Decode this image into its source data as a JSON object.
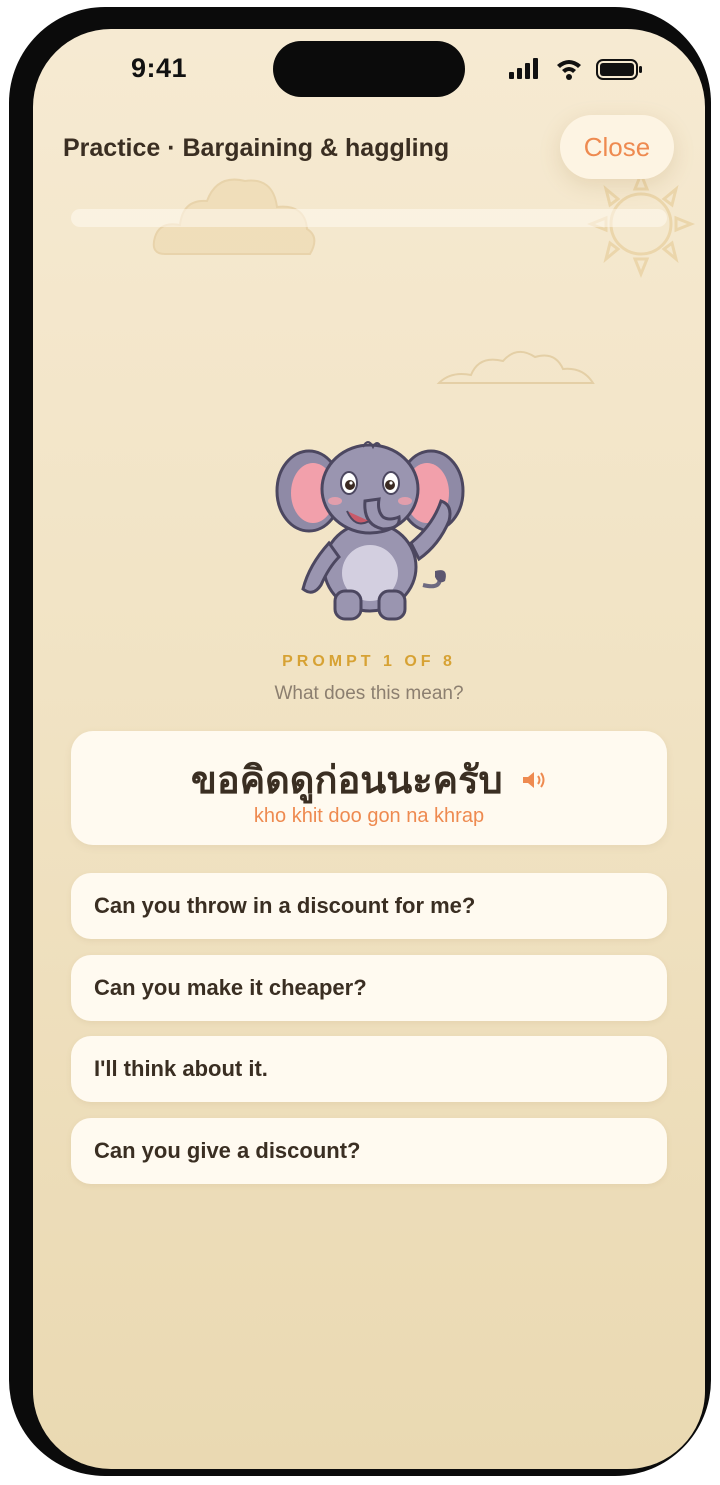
{
  "status_bar": {
    "time": "9:41"
  },
  "header": {
    "title": "Practice · Bargaining & haggling",
    "close_label": "Close"
  },
  "progress": {
    "fraction": 0.0
  },
  "prompt": {
    "counter": "PROMPT 1 OF 8",
    "question": "What does this mean?",
    "thai_phrase": "ขอคิดดูก่อนนะครับ",
    "romanization": "kho khit doo gon na khrap"
  },
  "options": [
    {
      "label": "Can you throw in a discount for me?"
    },
    {
      "label": "Can you make it cheaper?"
    },
    {
      "label": "I'll think about it."
    },
    {
      "label": "Can you give a discount?"
    }
  ],
  "colors": {
    "accent": "#ee8a50",
    "counter": "#d7a234",
    "text": "#3a2e22",
    "background": "#f3e6c8"
  },
  "icons": {
    "mascot": "elephant-mascot",
    "audio": "speaker-icon"
  }
}
